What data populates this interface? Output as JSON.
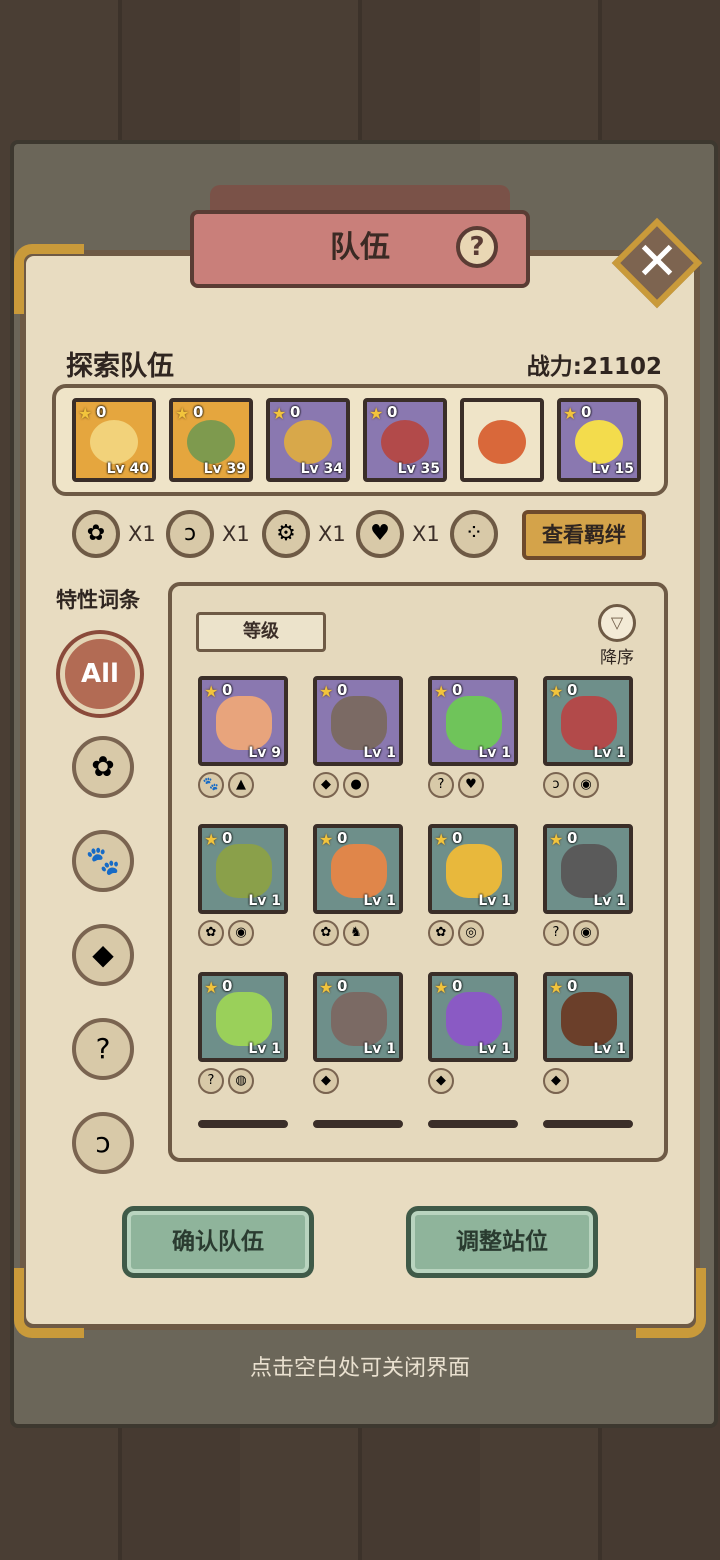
{
  "window": {
    "title": "队伍",
    "help_icon": "?",
    "close_icon": "✕"
  },
  "team": {
    "label": "探索队伍",
    "power": "战力:21102",
    "heroes": [
      {
        "stars": "0",
        "level": "Lv 40",
        "bg": "#e5a63e",
        "face": "#f2d27a"
      },
      {
        "stars": "0",
        "level": "Lv 39",
        "bg": "#e5a63e",
        "face": "#7e9a4e"
      },
      {
        "stars": "0",
        "level": "Lv 34",
        "bg": "#8a78b0",
        "face": "#d8a84a"
      },
      {
        "stars": "0",
        "level": "Lv 35",
        "bg": "#8a78b0",
        "face": "#b24a4a"
      },
      {
        "stars": "",
        "level": "",
        "bg": "#efe4c8",
        "face": "#d9683a"
      },
      {
        "stars": "0",
        "level": "Lv 15",
        "bg": "#8a78b0",
        "face": "#f3dc4c"
      }
    ]
  },
  "bonds": {
    "items": [
      {
        "icon": "leaf",
        "glyph": "✿",
        "count": "X1"
      },
      {
        "icon": "swirl",
        "glyph": "ↄ",
        "count": "X1"
      },
      {
        "icon": "gear",
        "glyph": "⚙",
        "count": "X1"
      },
      {
        "icon": "heart",
        "glyph": "♥",
        "count": "X1"
      },
      {
        "icon": "dots",
        "glyph": "⁘",
        "count": ""
      }
    ],
    "view_button": "查看羁绊"
  },
  "traits": {
    "label": "特性词条",
    "filters": [
      {
        "name": "all",
        "glyph": "All"
      },
      {
        "name": "leaf",
        "glyph": "✿"
      },
      {
        "name": "paw",
        "glyph": "🐾"
      },
      {
        "name": "crystal",
        "glyph": "◆"
      },
      {
        "name": "question",
        "glyph": "?"
      },
      {
        "name": "swirl",
        "glyph": "ↄ"
      }
    ]
  },
  "list": {
    "sort_label": "等级",
    "order_label": "降序",
    "monsters": [
      {
        "stars": "0",
        "level": "Lv 9",
        "bg": "#8a78b0",
        "face": "#e8a47c",
        "traits": [
          "🐾",
          "▲"
        ]
      },
      {
        "stars": "0",
        "level": "Lv 1",
        "bg": "#8a78b0",
        "face": "#7b6a64",
        "traits": [
          "◆",
          "●"
        ]
      },
      {
        "stars": "0",
        "level": "Lv 1",
        "bg": "#8a78b0",
        "face": "#6fc45a",
        "traits": [
          "?",
          "♥"
        ]
      },
      {
        "stars": "0",
        "level": "Lv 1",
        "bg": "#6e8f8a",
        "face": "#b24a4a",
        "traits": [
          "ↄ",
          "◉"
        ]
      },
      {
        "stars": "0",
        "level": "Lv 1",
        "bg": "#6e8f8a",
        "face": "#8aa04a",
        "traits": [
          "✿",
          "◉"
        ]
      },
      {
        "stars": "0",
        "level": "Lv 1",
        "bg": "#6e8f8a",
        "face": "#e0864a",
        "traits": [
          "✿",
          "♞"
        ]
      },
      {
        "stars": "0",
        "level": "Lv 1",
        "bg": "#6e8f8a",
        "face": "#e8b83c",
        "traits": [
          "✿",
          "◎"
        ]
      },
      {
        "stars": "0",
        "level": "Lv 1",
        "bg": "#6e8f8a",
        "face": "#5a5a5a",
        "traits": [
          "?",
          "◉"
        ]
      },
      {
        "stars": "0",
        "level": "Lv 1",
        "bg": "#6e8f8a",
        "face": "#9ad05a",
        "traits": [
          "?",
          "◍"
        ]
      },
      {
        "stars": "0",
        "level": "Lv 1",
        "bg": "#6e8f8a",
        "face": "#7b6a64",
        "traits": [
          "◆"
        ]
      },
      {
        "stars": "0",
        "level": "Lv 1",
        "bg": "#6e8f8a",
        "face": "#8a5ac4",
        "traits": [
          "◆"
        ]
      },
      {
        "stars": "0",
        "level": "Lv 1",
        "bg": "#6e8f8a",
        "face": "#6b3f2a",
        "traits": [
          "◆"
        ]
      }
    ]
  },
  "buttons": {
    "confirm": "确认队伍",
    "adjust": "调整站位"
  },
  "hint": "点击空白处可关闭界面"
}
